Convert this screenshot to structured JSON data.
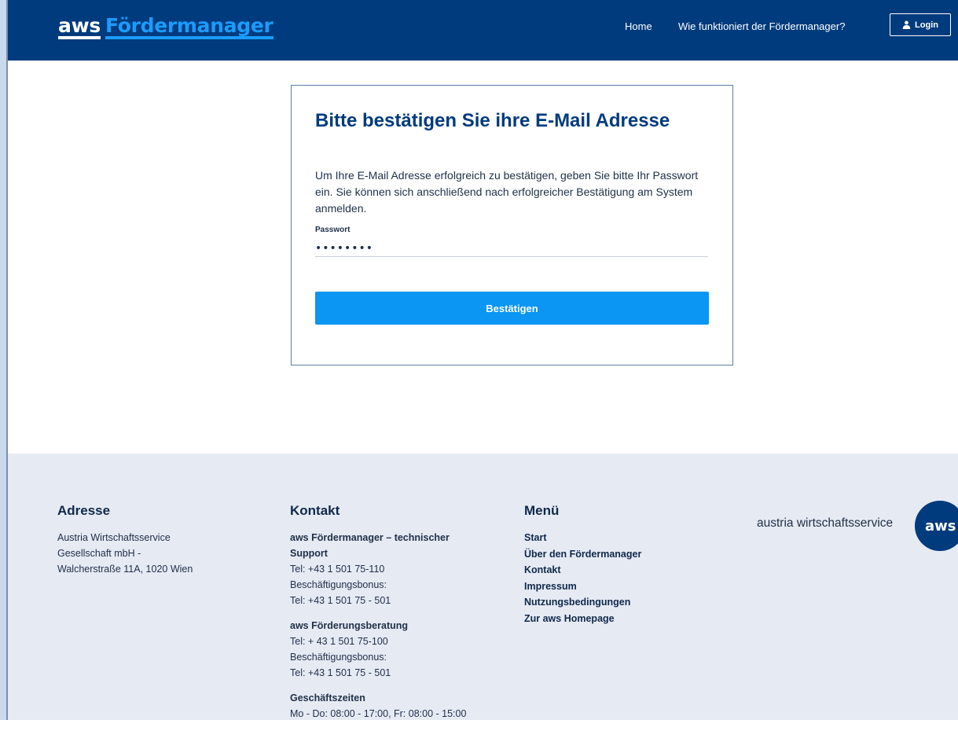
{
  "header": {
    "logo_aws": "aws",
    "logo_product": "Fördermanager",
    "nav": [
      {
        "label": "Home"
      },
      {
        "label": "Wie funktioniert der Fördermanager?"
      }
    ],
    "login_label": "Login",
    "login_icon": "user-icon",
    "background_color": "#003b7d",
    "accent_color": "#1a9cff"
  },
  "card": {
    "title": "Bitte bestätigen Sie ihre E-Mail Adresse",
    "description": "Um Ihre E-Mail Adresse erfolgreich zu bestätigen, geben Sie bitte Ihr Passwort ein. Sie können sich anschließend nach erfolgreicher Bestätigung am System anmelden.",
    "password_label": "Passwort",
    "password_value": "••••••••",
    "submit_label": "Bestätigen",
    "button_color": "#0a96f2"
  },
  "footer": {
    "address": {
      "heading": "Adresse",
      "lines": [
        "Austria Wirtschaftsservice",
        "Gesellschaft mbH -",
        "Walcherstraße 11A, 1020 Wien"
      ]
    },
    "contact": {
      "heading": "Kontakt",
      "blocks": [
        {
          "title": "aws Fördermanager – technischer Support",
          "lines": [
            "Tel: +43 1 501 75-110",
            "Beschäftigungsbonus:",
            "Tel: +43 1 501 75 - 501"
          ]
        },
        {
          "title": "aws Förderungsberatung",
          "lines": [
            "Tel: + 43 1 501 75-100",
            "Beschäftigungsbonus:",
            "Tel: +43 1 501 75 - 501"
          ]
        },
        {
          "title": "Geschäftszeiten",
          "lines": [
            "Mo - Do: 08:00 - 17:00, Fr: 08:00 - 15:00"
          ]
        }
      ]
    },
    "menu": {
      "heading": "Menü",
      "items": [
        "Start",
        "Über den Fördermanager",
        "Kontakt",
        "Impressum",
        "Nutzungsbedingungen",
        "Zur aws Homepage"
      ]
    },
    "brand": {
      "text": "austria wirtschaftsservice",
      "badge": "aws"
    },
    "background_color": "#e6eaf3"
  }
}
